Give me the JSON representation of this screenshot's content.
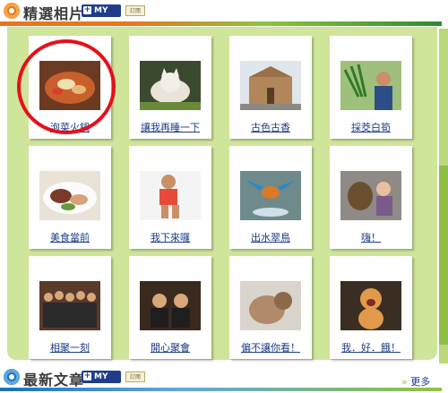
{
  "header": {
    "title": "精選相片",
    "myyahoo": "MY",
    "badge": "訂閱"
  },
  "photos": [
    {
      "caption": "泡菜火鍋",
      "icon": "food-photo"
    },
    {
      "caption": "讓我再睡一下",
      "icon": "cat-photo"
    },
    {
      "caption": "古色古香",
      "icon": "building-photo"
    },
    {
      "caption": "採茭白筍",
      "icon": "person-photo"
    },
    {
      "caption": "美食當前",
      "icon": "food-photo"
    },
    {
      "caption": "我下來囉",
      "icon": "child-photo"
    },
    {
      "caption": "出水翠鳥",
      "icon": "bird-photo"
    },
    {
      "caption": "嗨！",
      "icon": "dog-photo"
    },
    {
      "caption": "相聚一刻",
      "icon": "group-photo"
    },
    {
      "caption": "開心聚會",
      "icon": "party-photo"
    },
    {
      "caption": "偏不讓你看！",
      "icon": "cat-photo"
    },
    {
      "caption": "我．好．餓！",
      "icon": "cat-photo"
    }
  ],
  "footer": {
    "title": "最新文章",
    "myyahoo": "MY",
    "badge": "訂閱",
    "more": "更多"
  },
  "colors": {
    "panel": "#cfe59a",
    "accent_orange": "#e8761a",
    "link": "#1b3c86",
    "highlight": "#e5101a"
  }
}
